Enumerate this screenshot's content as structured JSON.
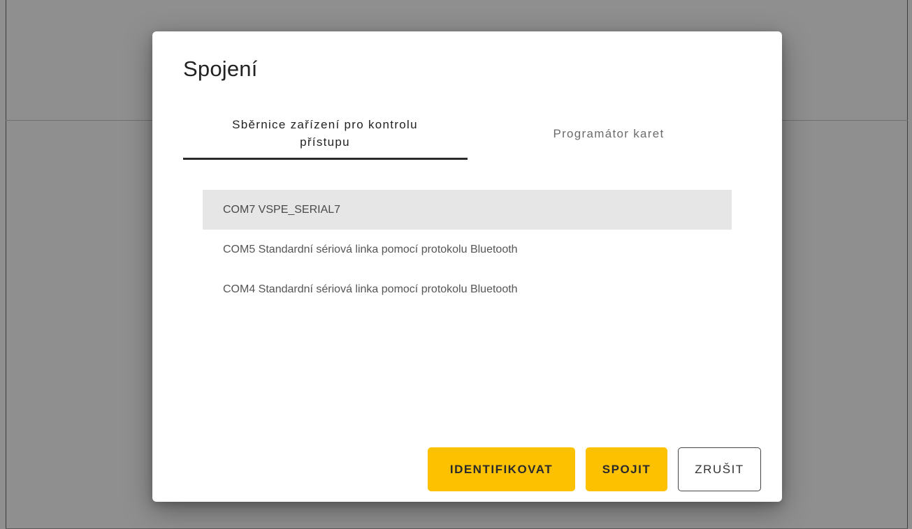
{
  "dialog": {
    "title": "Spojení",
    "tabs": [
      {
        "label": "Sběrnice zařízení pro kontrolu přístupu",
        "active": true
      },
      {
        "label": "Programátor karet",
        "active": false
      }
    ],
    "ports": [
      {
        "label": "COM7 VSPE_SERIAL7",
        "selected": true
      },
      {
        "label": "COM5 Standardní sériová linka pomocí protokolu Bluetooth",
        "selected": false
      },
      {
        "label": "COM4 Standardní sériová linka pomocí protokolu Bluetooth",
        "selected": false
      }
    ],
    "buttons": {
      "identify_label": "IDENTIFIKOVAT",
      "connect_label": "SPOJIT",
      "cancel_label": "ZRUŠIT"
    }
  },
  "colors": {
    "accent": "#fdc100",
    "backdrop": "#8f8f8f",
    "selected_row": "#e6e6e6"
  }
}
